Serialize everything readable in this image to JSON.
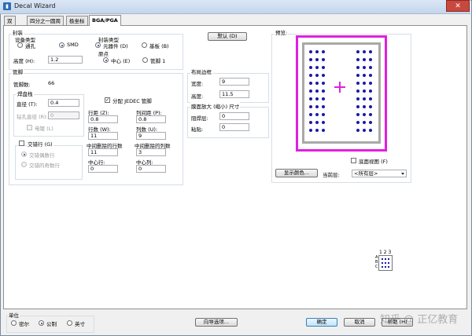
{
  "window": {
    "title": "Decal Wizard",
    "icon_glyph": "▮",
    "close_glyph": "✕"
  },
  "tabs": [
    {
      "label": "双"
    },
    {
      "label": "四分之一圆周"
    },
    {
      "label": "极坐标"
    },
    {
      "label": "BGA/PGA"
    }
  ],
  "package": {
    "group_label": "封装",
    "device_type": {
      "label": "设备类型",
      "options": [
        "通孔",
        "SMD"
      ],
      "selected": "SMD"
    },
    "height": {
      "label": "高度 (H):",
      "value": "1.2"
    },
    "decal_type": {
      "label": "封装类型",
      "options": [
        "元器件 (D)",
        "基板 (B)"
      ],
      "selected": "元器件 (D)"
    },
    "origin": {
      "label": "原点",
      "options": [
        "中心 (E)",
        "管脚 1"
      ],
      "selected": "中心 (E)"
    },
    "default_button": "默认 (D)"
  },
  "pins": {
    "group_label": "管脚",
    "count_label": "管脚数:",
    "count_value": "66",
    "pad": {
      "label": "焊盘栈",
      "diameter": {
        "label": "直径 (T):",
        "value": "0.4"
      },
      "drill": {
        "label": "钻孔直径 (R):",
        "value": "0"
      },
      "plated": {
        "label": "电镀 (L)"
      }
    },
    "jedec": {
      "label": "分配 JEDEC 管脚",
      "checked": true
    },
    "row_spacing": {
      "label": "行距 (Z):",
      "value": "0.8"
    },
    "col_spacing": {
      "label": "列间距 (P):",
      "value": "0.8"
    },
    "rows": {
      "label": "行数 (W):",
      "value": "11"
    },
    "cols": {
      "label": "列数 (U):",
      "value": "9"
    },
    "mid_empty_rows": {
      "label": "中间删除的行数",
      "value": "11"
    },
    "mid_empty_cols": {
      "label": "中间删除的列数",
      "value": "3"
    },
    "center_row": {
      "label": "中心行:",
      "value": "0"
    },
    "center_col": {
      "label": "中心列:",
      "value": "0"
    },
    "stagger": {
      "label": "交错行 (G)",
      "options": [
        "交错偶数行",
        "交错的奇数行"
      ],
      "selected": "交错偶数行"
    }
  },
  "placement_outline": {
    "group_label": "布局边框",
    "width": {
      "label": "宽度:",
      "value": "9"
    },
    "height": {
      "label": "高度:",
      "value": "11.5"
    }
  },
  "courtyard": {
    "group_label": "膜面放大 (缩小) 尺寸",
    "solder_mask": {
      "label": "阻焊层:",
      "value": "0"
    },
    "paste": {
      "label": "粘贴:",
      "value": "0"
    }
  },
  "preview": {
    "group_label": "预览:",
    "bottom_view": {
      "label": "底面视图 (F)"
    },
    "display_colors_button": "显示颜色...",
    "current_layer_label": "当前层:",
    "current_layer_value": "<所有层>",
    "accent_color": "#e020e0",
    "pad_color": "#1a1aa8",
    "pad_rows": 11,
    "pad_cols_each_side": 3
  },
  "index_legend": {
    "cols": "1 2 3",
    "rows": "A\nB\nC"
  },
  "units": {
    "group_label": "单位",
    "options": [
      "密尔",
      "公制",
      "英寸"
    ],
    "selected": "公制"
  },
  "buttons": {
    "wizard_options": "向导选项...",
    "ok": "确定",
    "cancel": "取消",
    "help": "帮助 (H)"
  },
  "watermark": "知乎 @ 正亿教育"
}
